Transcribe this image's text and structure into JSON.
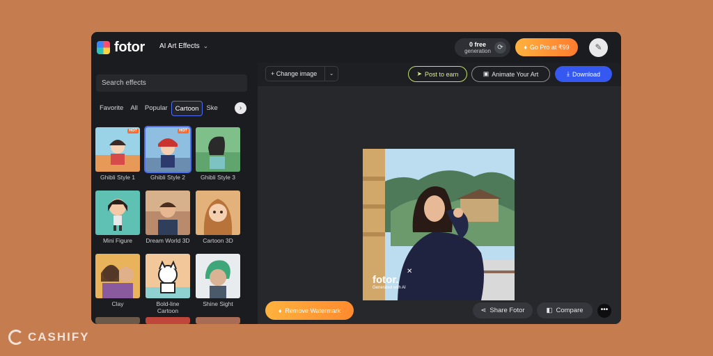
{
  "header": {
    "logo_text": "fotor",
    "effects_menu": "AI Art Effects",
    "free_generation": {
      "count": "0 free",
      "label": "generation"
    },
    "go_pro": "Go Pro at ₹99"
  },
  "sidebar": {
    "search_placeholder": "Search effects",
    "tabs": [
      "Favorite",
      "All",
      "Popular",
      "Cartoon",
      "Ske"
    ],
    "active_tab": "Cartoon",
    "effects": [
      {
        "label": "Ghibli Style 1",
        "hot": "HOT"
      },
      {
        "label": "Ghibli Style 2",
        "hot": "HOT"
      },
      {
        "label": "Ghibli Style 3"
      },
      {
        "label": "Mini Figure"
      },
      {
        "label": "Dream World 3D"
      },
      {
        "label": "Cartoon 3D"
      },
      {
        "label": "Clay"
      },
      {
        "label": "Bold-line Cartoon"
      },
      {
        "label": "Shine Sight"
      }
    ]
  },
  "toolbar": {
    "change_image": "Change image",
    "post_to_earn": "Post to earn",
    "animate": "Animate Your Art",
    "download": "Download"
  },
  "canvas": {
    "watermark_brand": "fotor.",
    "watermark_sub": "Generated with AI"
  },
  "footer": {
    "remove_watermark": "Remove Watermark",
    "share": "Share Fotor",
    "compare": "Compare"
  },
  "site_watermark": "CASHIFY",
  "colors": {
    "background": "#c57d50",
    "panel": "#1b1c1f",
    "accent_blue": "#3559f0",
    "accent_orange": "#ff8a2e"
  }
}
